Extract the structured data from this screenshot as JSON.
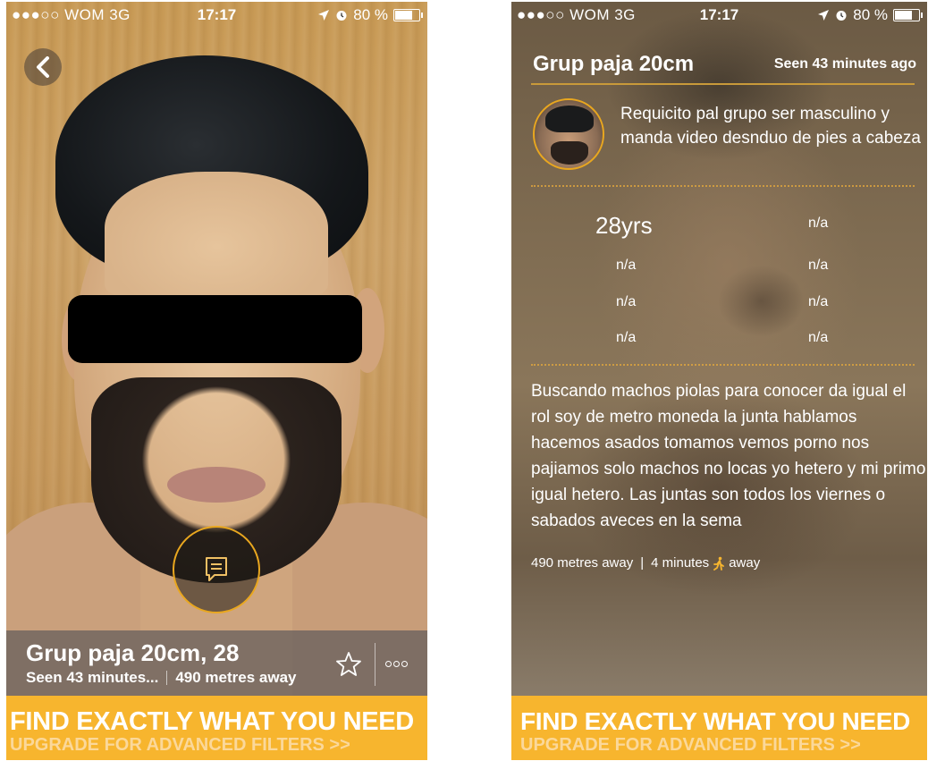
{
  "status_bar": {
    "carrier": "●●●○○ WOM  3G",
    "time": "17:17",
    "battery": "80 %",
    "battery_level": 0.8
  },
  "left": {
    "profile": {
      "name_age": "Grup paja 20cm, 28",
      "seen": "Seen 43 minutes...",
      "distance": "490 metres away"
    }
  },
  "right": {
    "header": {
      "name": "Grup paja 20cm",
      "seen": "Seen 43 minutes ago"
    },
    "headline": "Requicito pal grupo ser masculino y manda video desnduo de pies a cabeza",
    "stats": {
      "age": "28yrs",
      "values": [
        "n/a",
        "n/a",
        "n/a",
        "n/a",
        "n/a",
        "n/a",
        "n/a"
      ]
    },
    "description": "Buscando machos piolas para conocer da igual el rol soy de metro moneda  la junta hablamos hacemos asados tomamos vemos porno nos pajiamos solo machos no locas yo hetero y mi primo igual hetero. Las juntas son todos los viernes o sabados aveces en la sema",
    "distance": "490 metres away",
    "separator": "|",
    "walk_time": "4 minutes",
    "walk_suffix": "away"
  },
  "promo": {
    "title": "FIND EXACTLY WHAT YOU NEED",
    "subtitle": "UPGRADE FOR ADVANCED FILTERS >>"
  },
  "colors": {
    "accent": "#f7b52e",
    "ring": "#e9a71f"
  },
  "icons": [
    "back-chevron-icon",
    "chat-icon",
    "star-icon",
    "more-icon",
    "location-arrow-icon",
    "alarm-icon",
    "battery-icon",
    "walking-person-icon"
  ]
}
